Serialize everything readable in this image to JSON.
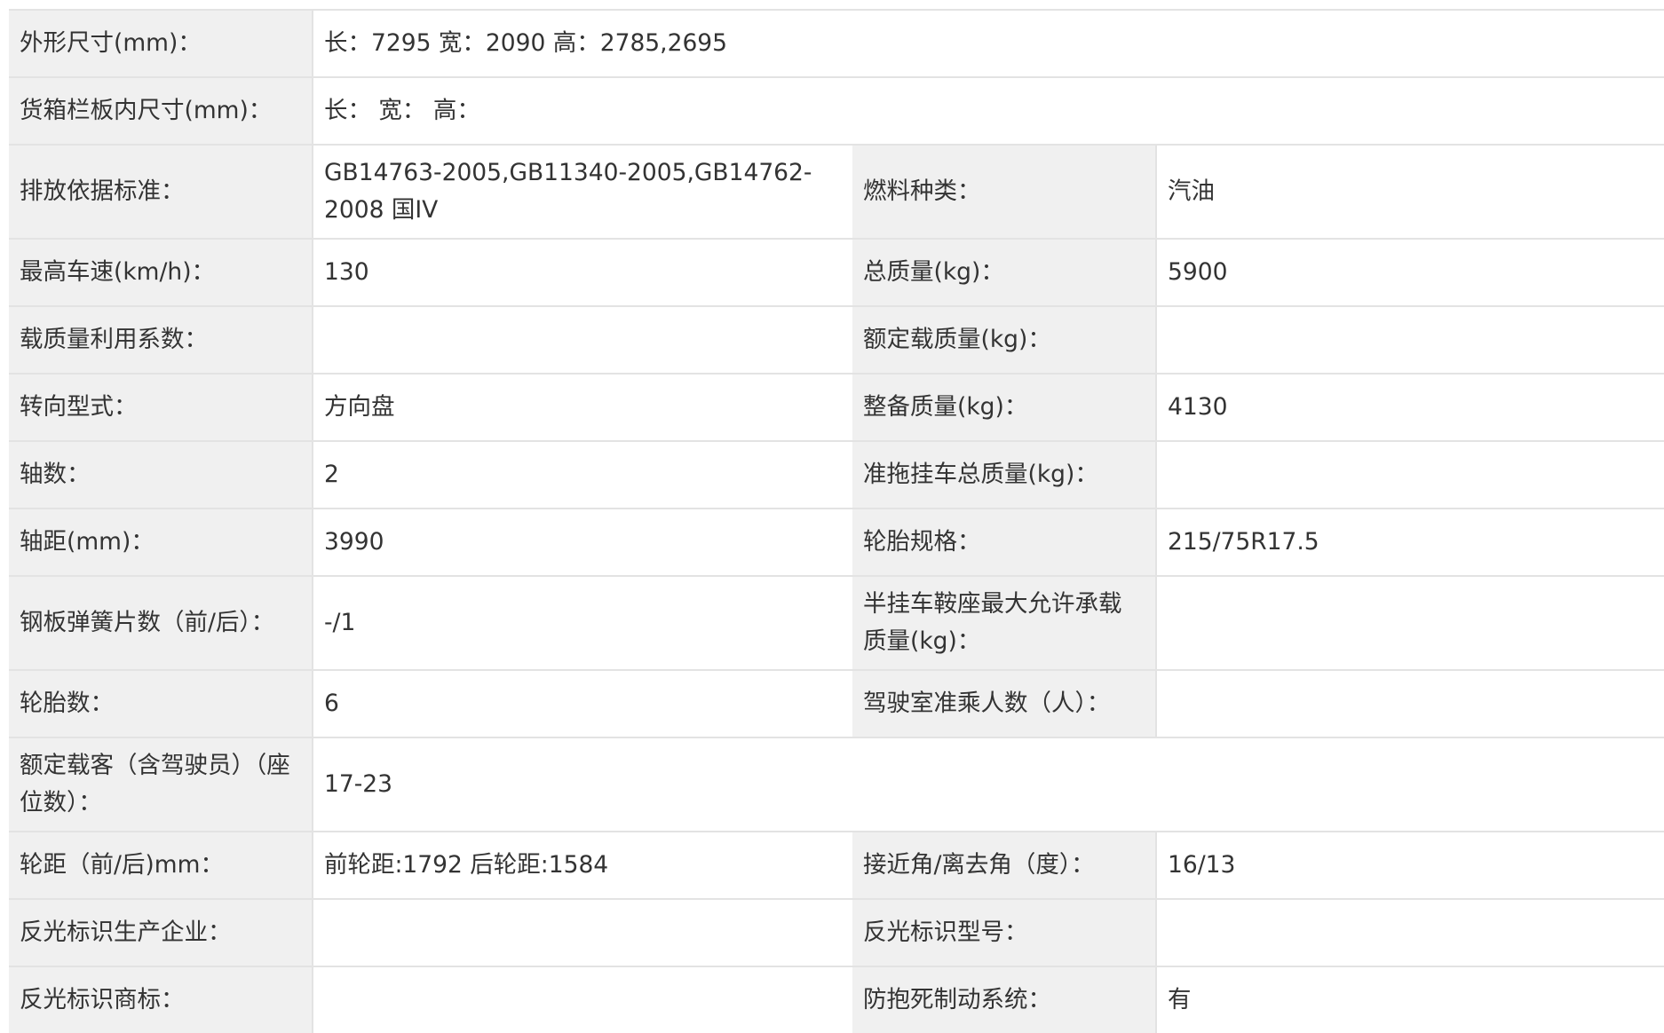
{
  "rows": [
    {
      "type": "wide",
      "label": "外形尺寸(mm)：",
      "value": "长：7295 宽：2090 高：2785,2695"
    },
    {
      "type": "wide",
      "label": "货箱栏板内尺寸(mm)：",
      "value": "长：  宽：  高："
    },
    {
      "type": "double",
      "tall": true,
      "label1": "排放依据标准：",
      "value1": "GB14763-2005,GB11340-2005,GB14762-2008 国IV",
      "label2": "燃料种类：",
      "value2": "汽油"
    },
    {
      "type": "double",
      "label1": "最高车速(km/h)：",
      "value1": "130",
      "label2": "总质量(kg)：",
      "value2": "5900"
    },
    {
      "type": "double",
      "label1": "载质量利用系数：",
      "value1": "",
      "label2": "额定载质量(kg)：",
      "value2": ""
    },
    {
      "type": "double",
      "label1": "转向型式：",
      "value1": "方向盘",
      "label2": "整备质量(kg)：",
      "value2": "4130"
    },
    {
      "type": "double",
      "label1": "轴数：",
      "value1": "2",
      "label2": "准拖挂车总质量(kg)：",
      "value2": ""
    },
    {
      "type": "double",
      "label1": "轴距(mm)：",
      "value1": "3990",
      "label2": "轮胎规格：",
      "value2": "215/75R17.5"
    },
    {
      "type": "double",
      "tall": true,
      "label1": "钢板弹簧片数（前/后）：",
      "value1": "-/1",
      "label2": "半挂车鞍座最大允许承载质量(kg)：",
      "value2": ""
    },
    {
      "type": "double",
      "label1": "轮胎数：",
      "value1": "6",
      "label2": "驾驶室准乘人数（人）：",
      "value2": ""
    },
    {
      "type": "wide",
      "tall": true,
      "label": "额定载客（含驾驶员）（座位数）：",
      "value": "17-23"
    },
    {
      "type": "double",
      "label1": "轮距（前/后)mm：",
      "value1": "前轮距:1792 后轮距:1584",
      "label2": "接近角/离去角（度）：",
      "value2": "16/13"
    },
    {
      "type": "double",
      "label1": "反光标识生产企业：",
      "value1": "",
      "label2": "反光标识型号：",
      "value2": ""
    },
    {
      "type": "double",
      "label1": "反光标识商标：",
      "value1": "",
      "label2": "防抱死制动系统：",
      "value2": "有"
    }
  ]
}
